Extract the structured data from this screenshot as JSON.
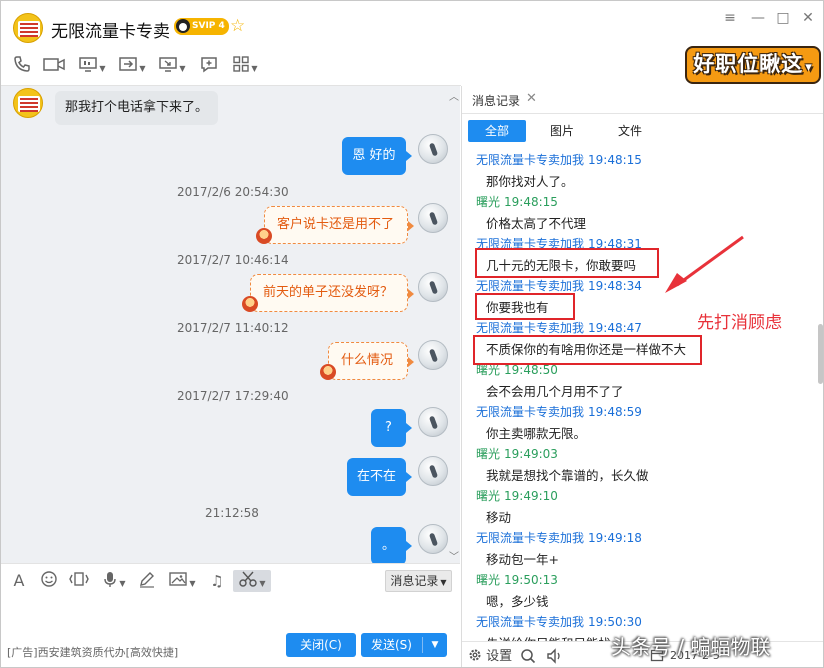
{
  "window": {
    "title": "无限流量卡专卖",
    "vip_badge": "SVIP 4",
    "star_icon": "star-icon",
    "controls": {
      "menu": "≡",
      "minimize": "—",
      "maximize": "□",
      "close": "✕"
    }
  },
  "toolbar": {
    "icons": [
      "phone-icon",
      "video-icon",
      "screen-share-icon",
      "transfer-file-icon",
      "remote-desktop-icon",
      "message-icon",
      "apps-icon"
    ],
    "ad_banner": "好职位瞅这"
  },
  "chat": {
    "messages": [
      {
        "side": "in",
        "text": "那我打个电话拿下来了。"
      },
      {
        "side": "out",
        "text": "恩 好的"
      },
      {
        "time": "2017/2/6 20:54:30"
      },
      {
        "side": "out",
        "style": "sticker",
        "text": "客户说卡还是用不了"
      },
      {
        "time": "2017/2/7 10:46:14"
      },
      {
        "side": "out",
        "style": "sticker",
        "text": "前天的单子还没发呀？"
      },
      {
        "time": "2017/2/7 11:40:12"
      },
      {
        "side": "out",
        "style": "sticker",
        "text": "什么情况"
      },
      {
        "time": "2017/2/7 17:29:40"
      },
      {
        "side": "out",
        "text": "?"
      },
      {
        "side": "out",
        "text": "在不在"
      },
      {
        "time": "21:12:58"
      },
      {
        "side": "out",
        "text": "。"
      }
    ]
  },
  "input_toolbar": {
    "icons": [
      "font-icon",
      "emoji-icon",
      "shake-icon",
      "voice-icon",
      "draw-icon",
      "image-icon",
      "music-icon",
      "scissors-icon"
    ],
    "history_button": "消息记录"
  },
  "footer": {
    "ad_text": "[广告]西安建筑资质代办[高效快捷]",
    "close_button": "关闭(C)",
    "send_button": "发送(S)"
  },
  "panel": {
    "tab": "消息记录",
    "subtabs": [
      "全部",
      "图片",
      "文件"
    ],
    "log": [
      {
        "sender": "无限流量卡专卖加我",
        "kind": "a",
        "time": "19:48:15",
        "text": "那你找对人了。"
      },
      {
        "sender": "曙光",
        "kind": "b",
        "time": "19:48:15",
        "text": "价格太高了不代理"
      },
      {
        "sender": "无限流量卡专卖加我",
        "kind": "a",
        "time": "19:48:31",
        "text": "几十元的无限卡，你敢要吗"
      },
      {
        "sender": "无限流量卡专卖加我",
        "kind": "a",
        "time": "19:48:34",
        "text": "你要我也有"
      },
      {
        "sender": "无限流量卡专卖加我",
        "kind": "a",
        "time": "19:48:47",
        "text": "不质保你的有啥用你还是一样做不大"
      },
      {
        "sender": "曙光",
        "kind": "b",
        "time": "19:48:50",
        "text": "会不会用几个月用不了了"
      },
      {
        "sender": "无限流量卡专卖加我",
        "kind": "a",
        "time": "19:48:59",
        "text": "你主卖哪款无限。"
      },
      {
        "sender": "曙光",
        "kind": "b",
        "time": "19:49:03",
        "text": "我就是想找个靠谱的，长久做"
      },
      {
        "sender": "曙光",
        "kind": "b",
        "time": "19:49:10",
        "text": "移动"
      },
      {
        "sender": "无限流量卡专卖加我",
        "kind": "a",
        "time": "19:49:18",
        "text": "移动包一年+"
      },
      {
        "sender": "曙光",
        "kind": "b",
        "time": "19:50:13",
        "text": "嗯，多少钱"
      },
      {
        "sender": "无限流量卡专卖加我",
        "kind": "a",
        "time": "19:50:30",
        "text": "先送给你兄能和只能找"
      }
    ],
    "bottom": {
      "settings": "设置",
      "date": "2017-2-5"
    }
  },
  "annotation": {
    "label": "先打消顾虑"
  },
  "watermark": "头条号 / 蝙蝠物联"
}
